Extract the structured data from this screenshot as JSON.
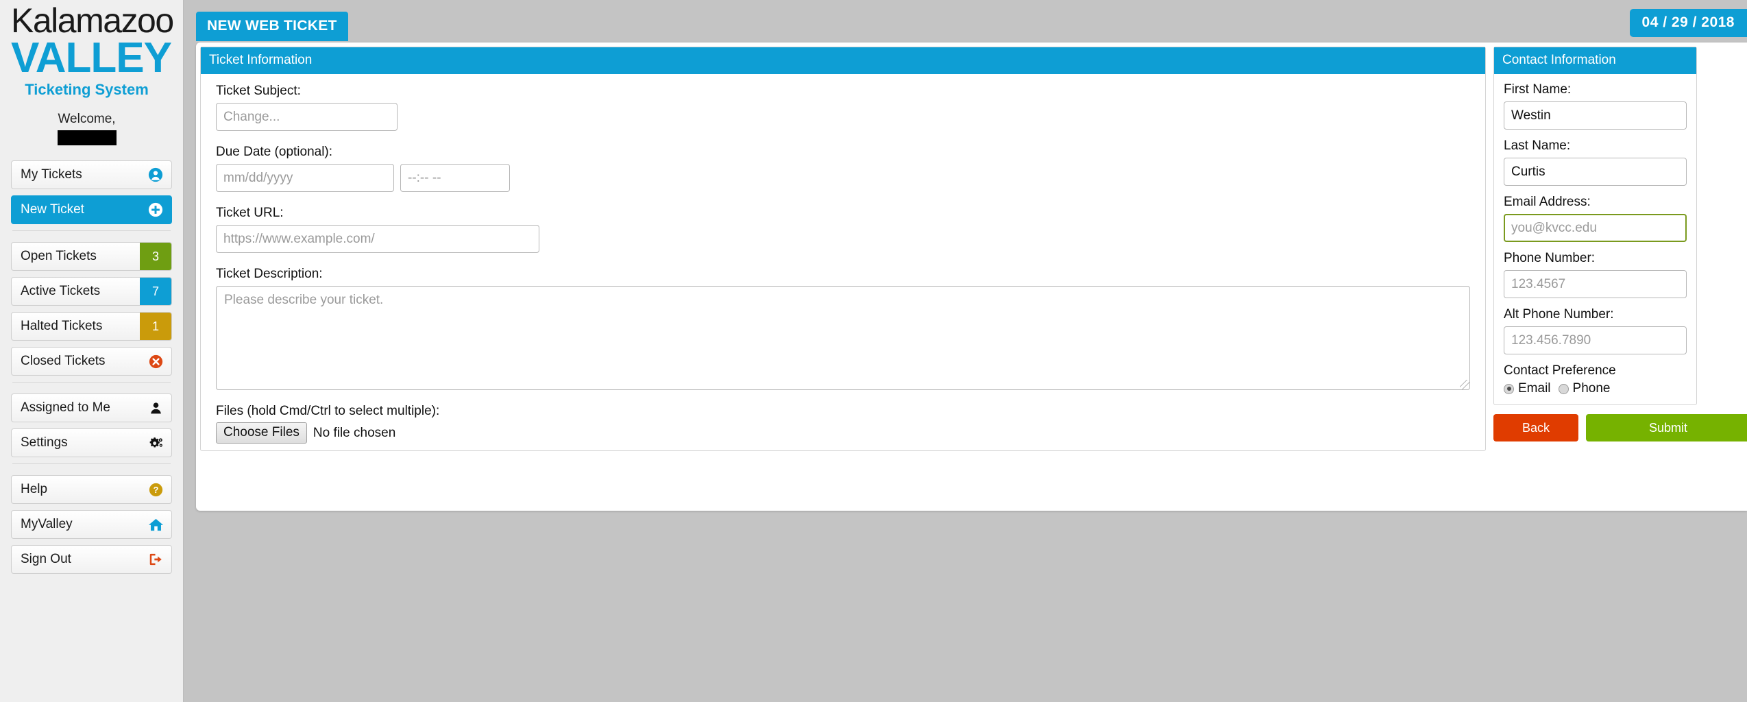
{
  "brand": {
    "line1": "Kalamazoo",
    "line2": "VALLEY",
    "line3": "Ticketing System",
    "accent_color": "#0e9ed4"
  },
  "welcome": {
    "greeting": "Welcome,",
    "username_redacted": ""
  },
  "sidebar": {
    "items": [
      {
        "label": "My Tickets",
        "icon": "user-circle-icon",
        "badge": null,
        "active": false
      },
      {
        "label": "New Ticket",
        "icon": "plus-circle-icon",
        "badge": null,
        "active": true
      },
      {
        "label": "Open Tickets",
        "icon": null,
        "badge": "3",
        "badge_color": "#6f9e12",
        "active": false
      },
      {
        "label": "Active Tickets",
        "icon": null,
        "badge": "7",
        "badge_color": "#0e9ed4",
        "active": false
      },
      {
        "label": "Halted Tickets",
        "icon": null,
        "badge": "1",
        "badge_color": "#ca9b0b",
        "active": false
      },
      {
        "label": "Closed Tickets",
        "icon": "x-circle-icon",
        "badge": null,
        "active": false
      },
      {
        "label": "Assigned to Me",
        "icon": "person-icon",
        "badge": null,
        "active": false
      },
      {
        "label": "Settings",
        "icon": "gears-icon",
        "badge": null,
        "active": false
      },
      {
        "label": "Help",
        "icon": "question-circle-icon",
        "badge": null,
        "active": false
      },
      {
        "label": "MyValley",
        "icon": "home-icon",
        "badge": null,
        "active": false
      },
      {
        "label": "Sign Out",
        "icon": "sign-out-icon",
        "badge": null,
        "active": false
      }
    ]
  },
  "header": {
    "page_title": "NEW WEB TICKET",
    "date": "04 / 29 / 2018"
  },
  "ticket_panel": {
    "title": "Ticket Information",
    "subject": {
      "label": "Ticket Subject:",
      "value": "",
      "placeholder": "Change..."
    },
    "due_date": {
      "label": "Due Date (optional):",
      "date_value": "",
      "date_placeholder": "mm/dd/yyyy",
      "time_value": "",
      "time_placeholder": "--:-- --"
    },
    "url": {
      "label": "Ticket URL:",
      "value": "",
      "placeholder": "https://www.example.com/"
    },
    "description": {
      "label": "Ticket Description:",
      "value": "",
      "placeholder": "Please describe your ticket."
    },
    "files": {
      "label": "Files (hold Cmd/Ctrl to select multiple):",
      "button_label": "Choose Files",
      "status": "No file chosen"
    }
  },
  "contact_panel": {
    "title": "Contact Information",
    "first_name": {
      "label": "First Name:",
      "value": "Westin",
      "placeholder": ""
    },
    "last_name": {
      "label": "Last Name:",
      "value": "Curtis",
      "placeholder": ""
    },
    "email": {
      "label": "Email Address:",
      "value": "",
      "placeholder": "you@kvcc.edu",
      "focused": true,
      "focus_color": "#7a9a1e"
    },
    "phone": {
      "label": "Phone Number:",
      "value": "",
      "placeholder": "123.4567"
    },
    "alt_phone": {
      "label": "Alt Phone Number:",
      "value": "",
      "placeholder": "123.456.7890"
    },
    "preference": {
      "label": "Contact Preference",
      "options": [
        {
          "label": "Email",
          "selected": true
        },
        {
          "label": "Phone",
          "selected": false
        }
      ]
    }
  },
  "actions": {
    "back_label": "Back",
    "back_color": "#e03c00",
    "submit_label": "Submit",
    "submit_color": "#76b200"
  }
}
